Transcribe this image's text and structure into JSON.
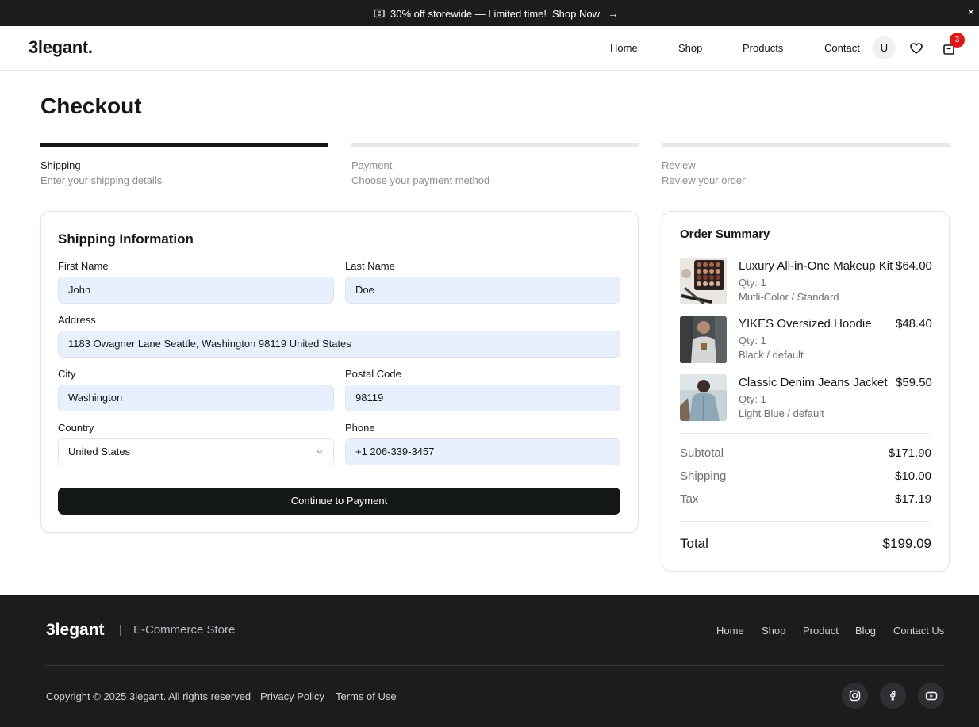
{
  "promo": {
    "icon": "ticket-icon",
    "text": "30% off storewide — Limited time!",
    "cta": "Shop Now",
    "arrow": "→",
    "close": "×"
  },
  "header": {
    "logo": "3legant.",
    "nav": [
      "Home",
      "Shop",
      "Products",
      "Contact"
    ],
    "user_initial": "U",
    "cart_count": "3",
    "icons": [
      "user-avatar",
      "heart-icon",
      "shopping-bag-icon"
    ]
  },
  "checkout": {
    "title": "Checkout",
    "steps": [
      {
        "label": "Shipping",
        "desc": "Enter your shipping details",
        "active": true
      },
      {
        "label": "Payment",
        "desc": "Choose your payment method",
        "active": false
      },
      {
        "label": "Review",
        "desc": "Review your order",
        "active": false
      }
    ]
  },
  "shipping": {
    "title": "Shipping Information",
    "fields": {
      "first_name": {
        "label": "First Name",
        "value": "John"
      },
      "last_name": {
        "label": "Last Name",
        "value": "Doe"
      },
      "address": {
        "label": "Address",
        "value": "1183 Owagner Lane Seattle, Washington 98119 United States"
      },
      "city": {
        "label": "City",
        "value": "Washington"
      },
      "postal_code": {
        "label": "Postal Code",
        "value": "98119"
      },
      "country": {
        "label": "Country",
        "value": "United States"
      },
      "phone": {
        "label": "Phone",
        "value": "+1 206-339-3457"
      }
    },
    "submit": "Continue to Payment"
  },
  "summary": {
    "title": "Order Summary",
    "items": [
      {
        "name": "Luxury All-in-One Makeup Kit",
        "price": "$64.00",
        "qty": "Qty: 1",
        "variant": "Mutli-Color / Standard"
      },
      {
        "name": "YIKES Oversized Hoodie",
        "price": "$48.40",
        "qty": "Qty: 1",
        "variant": "Black / default"
      },
      {
        "name": "Classic Denim Jeans Jacket",
        "price": "$59.50",
        "qty": "Qty: 1",
        "variant": "Light Blue / default"
      }
    ],
    "subtotal": {
      "label": "Subtotal",
      "value": "$171.90"
    },
    "shipping": {
      "label": "Shipping",
      "value": "$10.00"
    },
    "tax": {
      "label": "Tax",
      "value": "$17.19"
    },
    "total": {
      "label": "Total",
      "value": "$199.09"
    }
  },
  "footer": {
    "logo": "3legant",
    "separator": "|",
    "tagline": "E-Commerce Store",
    "nav": [
      "Home",
      "Shop",
      "Product",
      "Blog",
      "Contact Us"
    ],
    "copyright": "Copyright © 2025 3legant. All rights reserved",
    "privacy": "Privacy Policy",
    "terms": "Terms of Use",
    "social": [
      "instagram-icon",
      "facebook-icon",
      "youtube-icon"
    ]
  }
}
